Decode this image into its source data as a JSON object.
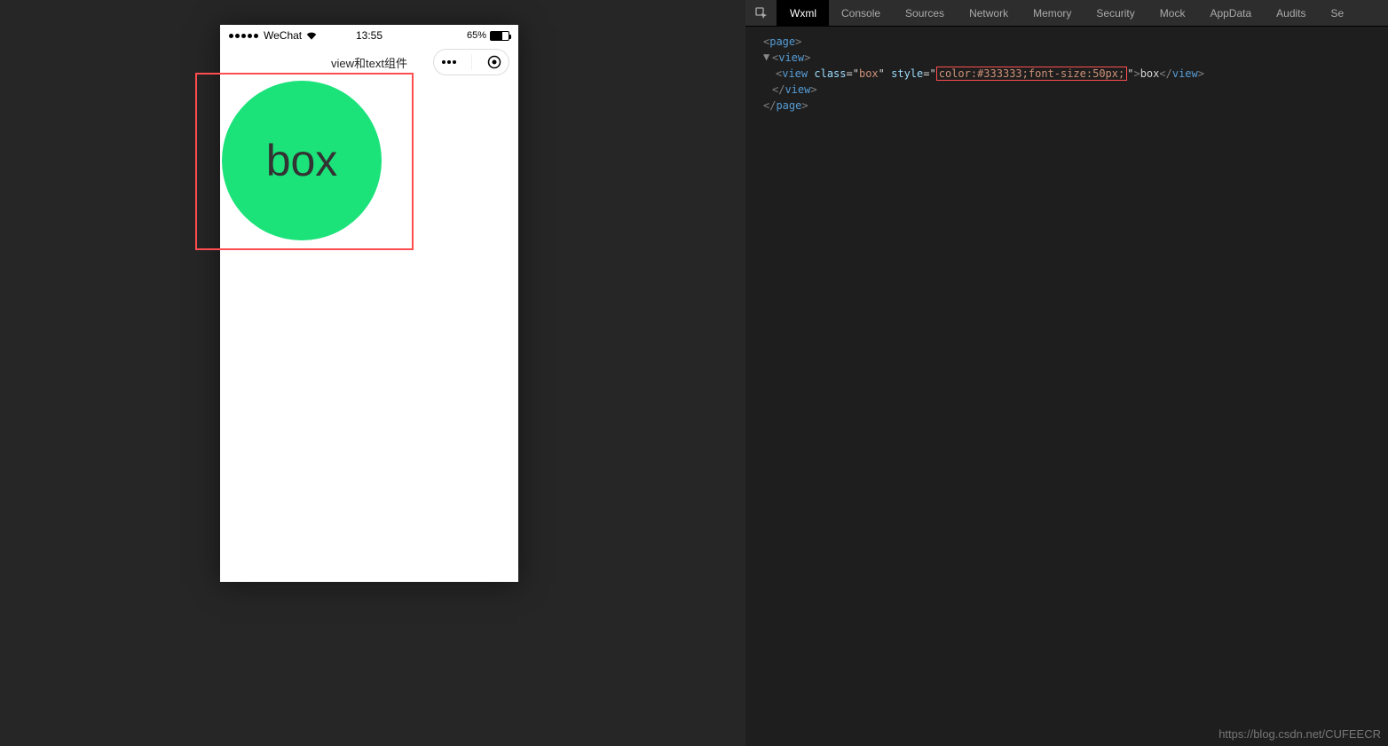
{
  "phone": {
    "carrier": "WeChat",
    "time": "13:55",
    "battery_percent": "65%",
    "nav_title": "view和text组件",
    "box_text": "box",
    "circle_color": "#1be37a",
    "box_text_color": "#333333"
  },
  "devtools": {
    "tabs": [
      "Wxml",
      "Console",
      "Sources",
      "Network",
      "Memory",
      "Security",
      "Mock",
      "AppData",
      "Audits",
      "Se"
    ],
    "active_tab": "Wxml",
    "wxml": {
      "page_open": "page",
      "view_open": "view",
      "inner_tag": "view",
      "class_attr_name": "class",
      "class_attr_value": "box",
      "style_attr_name": "style",
      "style_attr_value": "color:#333333;font-size:50px;",
      "inner_text": "box",
      "view_close": "view",
      "page_close": "page"
    }
  },
  "watermark": "https://blog.csdn.net/CUFEECR"
}
